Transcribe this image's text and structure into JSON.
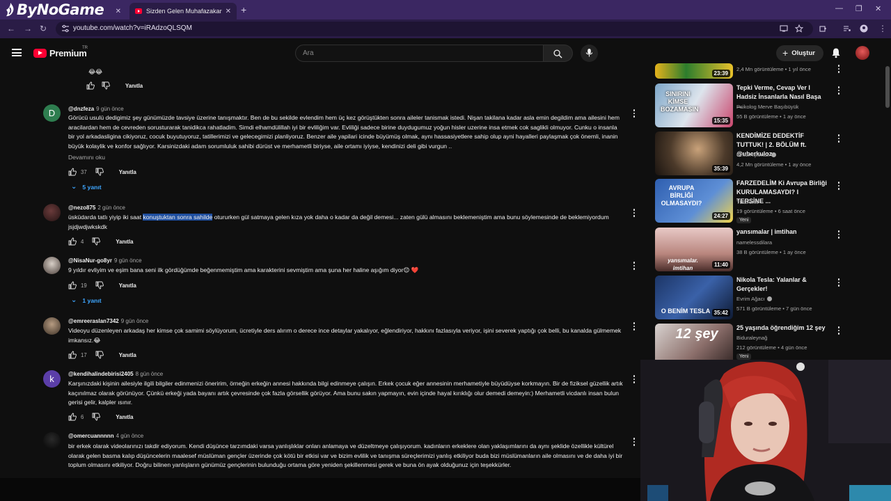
{
  "browser": {
    "brand": "ByNoGame",
    "tabs": [
      {
        "title": "...",
        "active": false
      },
      {
        "title": "Sizden Gelen Muhafazakar Date",
        "active": true
      }
    ],
    "url": "youtube.com/watch?v=iRAdzoQLSQM"
  },
  "masthead": {
    "logo_word": "Premium",
    "region": "TR",
    "search_placeholder": "Ara",
    "create_label": "Oluştur"
  },
  "comments": [
    {
      "author": "",
      "time": "",
      "text": "😂😂",
      "likes": "",
      "reply_label": "Yanıtla"
    },
    {
      "author": "@dnzfeza",
      "time": "9 gün önce",
      "avatar_letter": "D",
      "avatar_color": "#2e7d4f",
      "text": "Görücü usulü dedigimiz şey günümüzde tavsiye üzerine tanışmaktır. Ben de bu sekilde evlendim hem üç kez görüştükten sonra aileler tanismak istedi. Nişan takilana kadar asla emin degildim ama ailesini hem aracilardan hem de cevreden sorusturarak tanidikca rahatladim. Simdi elhamdülillah iyi bir evliliğim var. Evliliği sadece birine duydugumuz yoğun hisler uzerine insa etmek cok saglikli olmuyor. Cunku o insanla bir yol arkadasligina cikiyoruz, cocuk buyutuyoruz, tatillerimizi ve gelecegimizi planliyoruz. Benzer aile yapilari icinde büyümüş olmak, aynı hassasiyetlere sahip olup ayni hayalleri paylaşmak çok önemli, inanin büyük kolaylik ve konfor sağlıyor. Karsinizdaki adam sorumluluk sahibi dürüst ve merhametli biriyse, aile ortamı iyiyse, kendinizi deli gibi vurgun ..",
      "read_more": "Devamını oku",
      "likes": "37",
      "reply_label": "Yanıtla",
      "replies": "5 yanıt"
    },
    {
      "author": "@nezo875",
      "time": "2 gün önce",
      "text_before": "üsküdarda tatlı yiyip iki saat ",
      "text_highlight": "konuştuktan sonra sahilde",
      "text_after": " otururken gül satmaya gelen kıza yok daha o kadar da değil demesi... zaten gülü almasını beklemeniştim ama bunu söylemesinde de beklemiyordum jsjdjwdjwkskdk",
      "likes": "4",
      "reply_label": "Yanıtla"
    },
    {
      "author": "@NisaNur-go8yr",
      "time": "9 gün önce",
      "text": "9 yıldır evliyim ve eşim bana seni ilk gördüğümde beğenmemiştim ama karakterini sevmiştim ama şuna her haline aşığım diyor😊 ❤️",
      "likes": "19",
      "reply_label": "Yanıtla",
      "replies": "1 yanıt"
    },
    {
      "author": "@emreeraslan7342",
      "time": "9 gün önce",
      "text": "Videoyu düzenleyen arkadaş her kimse çok samimi söylüyorum, ücretiyle ders alırım o derece ince detaylar yakalıyor, eğlendiriyor, hakkını fazlasıyla veriyor, işini severek yaptığı çok belli, bu kanalda gülmemek imkansız.😂",
      "likes": "17",
      "reply_label": "Yanıtla"
    },
    {
      "author": "@kendihalindebirisi2405",
      "time": "8 gün önce",
      "avatar_letter": "k",
      "avatar_color": "#5b3ea8",
      "text": "Karşınızdaki kişinin ailesiyle ilgili bilgiler edinmenizi öneririm, örneğin erkeğin annesi hakkında bilgi edinmeye çalışın. Erkek çocuk eğer annesinin merhametiyle büyüdüyse korkmayın. Bir de fiziksel güzellik artık kaçınılmaz olarak görünüyor. Çünkü erkeği yada bayanı artık çevresinde çok fazla görsellik görüyor. Ama bunu sakın yapmayın, evin içinde hayal kırıklığı olur demedi demeyin:) Merhametli vicdanlı insan bulun gerisi gelir, kalpler ısınır.",
      "likes": "6",
      "reply_label": "Yanıtla"
    },
    {
      "author": "@omercuannnnn",
      "time": "4 gün önce",
      "text": "bir erkek olarak videolarınızı takdir ediyorum. Kendi düşünce tarzımdaki varsa yanlışlıklar onları anlamaya ve düzeltmeye çalışıyorum. kadınların erkeklere olan yaklaşımlarını da aynı şeklide özellikle kültürel olarak gelen basma kalıp düşüncelerin maalesef müslüman gençler üzerinde çok kötü bir etkisi var ve bizim evlilik ve tanışma süreçlerimizi yanlış etkiliyor buda bizi müslümanların aile olmasını ve de daha iyi bir toplum olmasını etkiliyor. Doğru bilinen yanlışların günümüz gençlerinin bulunduğu ortama göre yeniden şekillenmesi gerek ve buna ön ayak olduğunuz için teşekkürler."
    }
  ],
  "recommendations": [
    {
      "title": "",
      "channel": "",
      "meta": "2,4 Mn görüntüleme • 1 yıl önce",
      "duration": "23:39",
      "thumb_text": ""
    },
    {
      "title": "Tepki Verme, Cevap Ver I Hadsiz İnsanlarla Nasıl Başa ...",
      "channel": "Psikolog Merve Başıbüyük",
      "meta": "55 B görüntüleme • 1 ay önce",
      "duration": "15:35",
      "thumb_text": "SINIRINI KİMSE BOZAMASIN"
    },
    {
      "title": "KENDİMİZE DEDEKTİF TUTTUK! | 2. BÖLÜM ft. @uberkuloz",
      "channel": "Orkun Işıtmak",
      "meta": "4,2 Mn görüntüleme • 1 ay önce",
      "duration": "35:39",
      "thumb_text": ""
    },
    {
      "title": "FARZEDELİM Ki Avrupa Birliği KURULAMASAYDI? I TERSİNE ...",
      "channel": "TESAMtv",
      "meta": "19 görüntüleme • 6 saat önce",
      "duration": "24:27",
      "thumb_text": "AVRUPA BİRLİĞİ OLMASAYDI?",
      "badge": "Yeni"
    },
    {
      "title": "yansımalar | imtihan",
      "channel": "namelessdilara",
      "meta": "38 B görüntüleme • 1 ay önce",
      "duration": "11:40",
      "thumb_text": "yansımalar. imtihan"
    },
    {
      "title": "Nikola Tesla: Yalanlar & Gerçekler!",
      "channel": "Evrim Ağacı",
      "meta": "571 B görüntüleme • 7 gün önce",
      "duration": "35:42",
      "thumb_text": "O BENİM TESLA"
    },
    {
      "title": "25 yaşında öğrendiğim 12 şey",
      "channel": "Biduraleynağ",
      "meta": "212 görüntüleme • 4 gün önce",
      "duration": "",
      "thumb_text": "12 şey",
      "badge": "Yeni"
    }
  ],
  "colors": {
    "accent": "#3ea6ff",
    "brand_red": "#ff0033",
    "tab_strip": "#3b2762"
  }
}
